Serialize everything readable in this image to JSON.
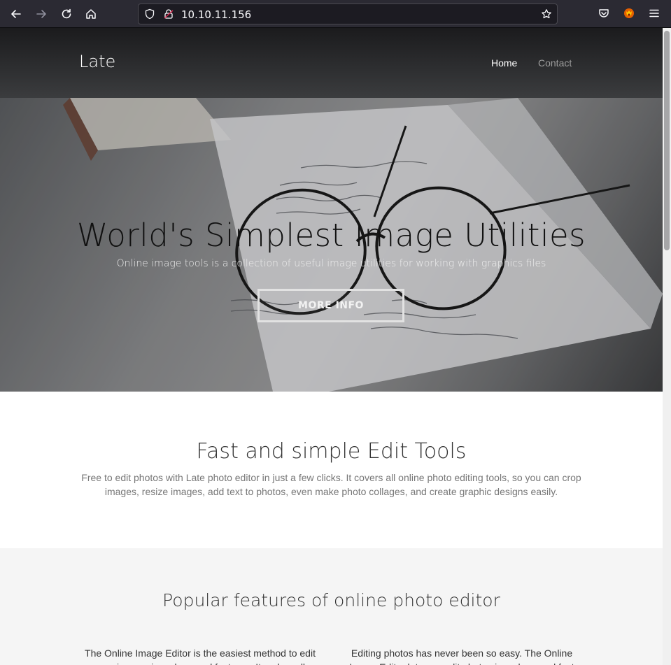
{
  "browser": {
    "url": "10.10.11.156",
    "colors": {
      "chrome_bg": "#2b2a33",
      "urlbar_bg": "#1c1b22",
      "text": "#fbfbfe"
    }
  },
  "site": {
    "brand": "Late",
    "nav": [
      {
        "label": "Home",
        "active": true
      },
      {
        "label": "Contact",
        "active": false
      }
    ]
  },
  "hero": {
    "title": "World's Simplest Image Utilities",
    "subtitle": "Online image tools is a collection of useful image utilities for working with graphics files",
    "button": "MORE INFO"
  },
  "edit_tools": {
    "title": "Fast and simple Edit Tools",
    "text": "Free to edit photos with Late photo editor in just a few clicks. It covers all online photo editing tools, so you can crop images, resize images, add text to photos, even make photo collages, and create graphic designs easily."
  },
  "features": {
    "title": "Popular features of online photo editor",
    "col1": "The Online Image Editor is the easiest method to edit your images in a clean and fast way. It makes all",
    "col2": "Editing photos has never been so easy. The Online Image Editor lets you edit photos in a clean and fast"
  }
}
